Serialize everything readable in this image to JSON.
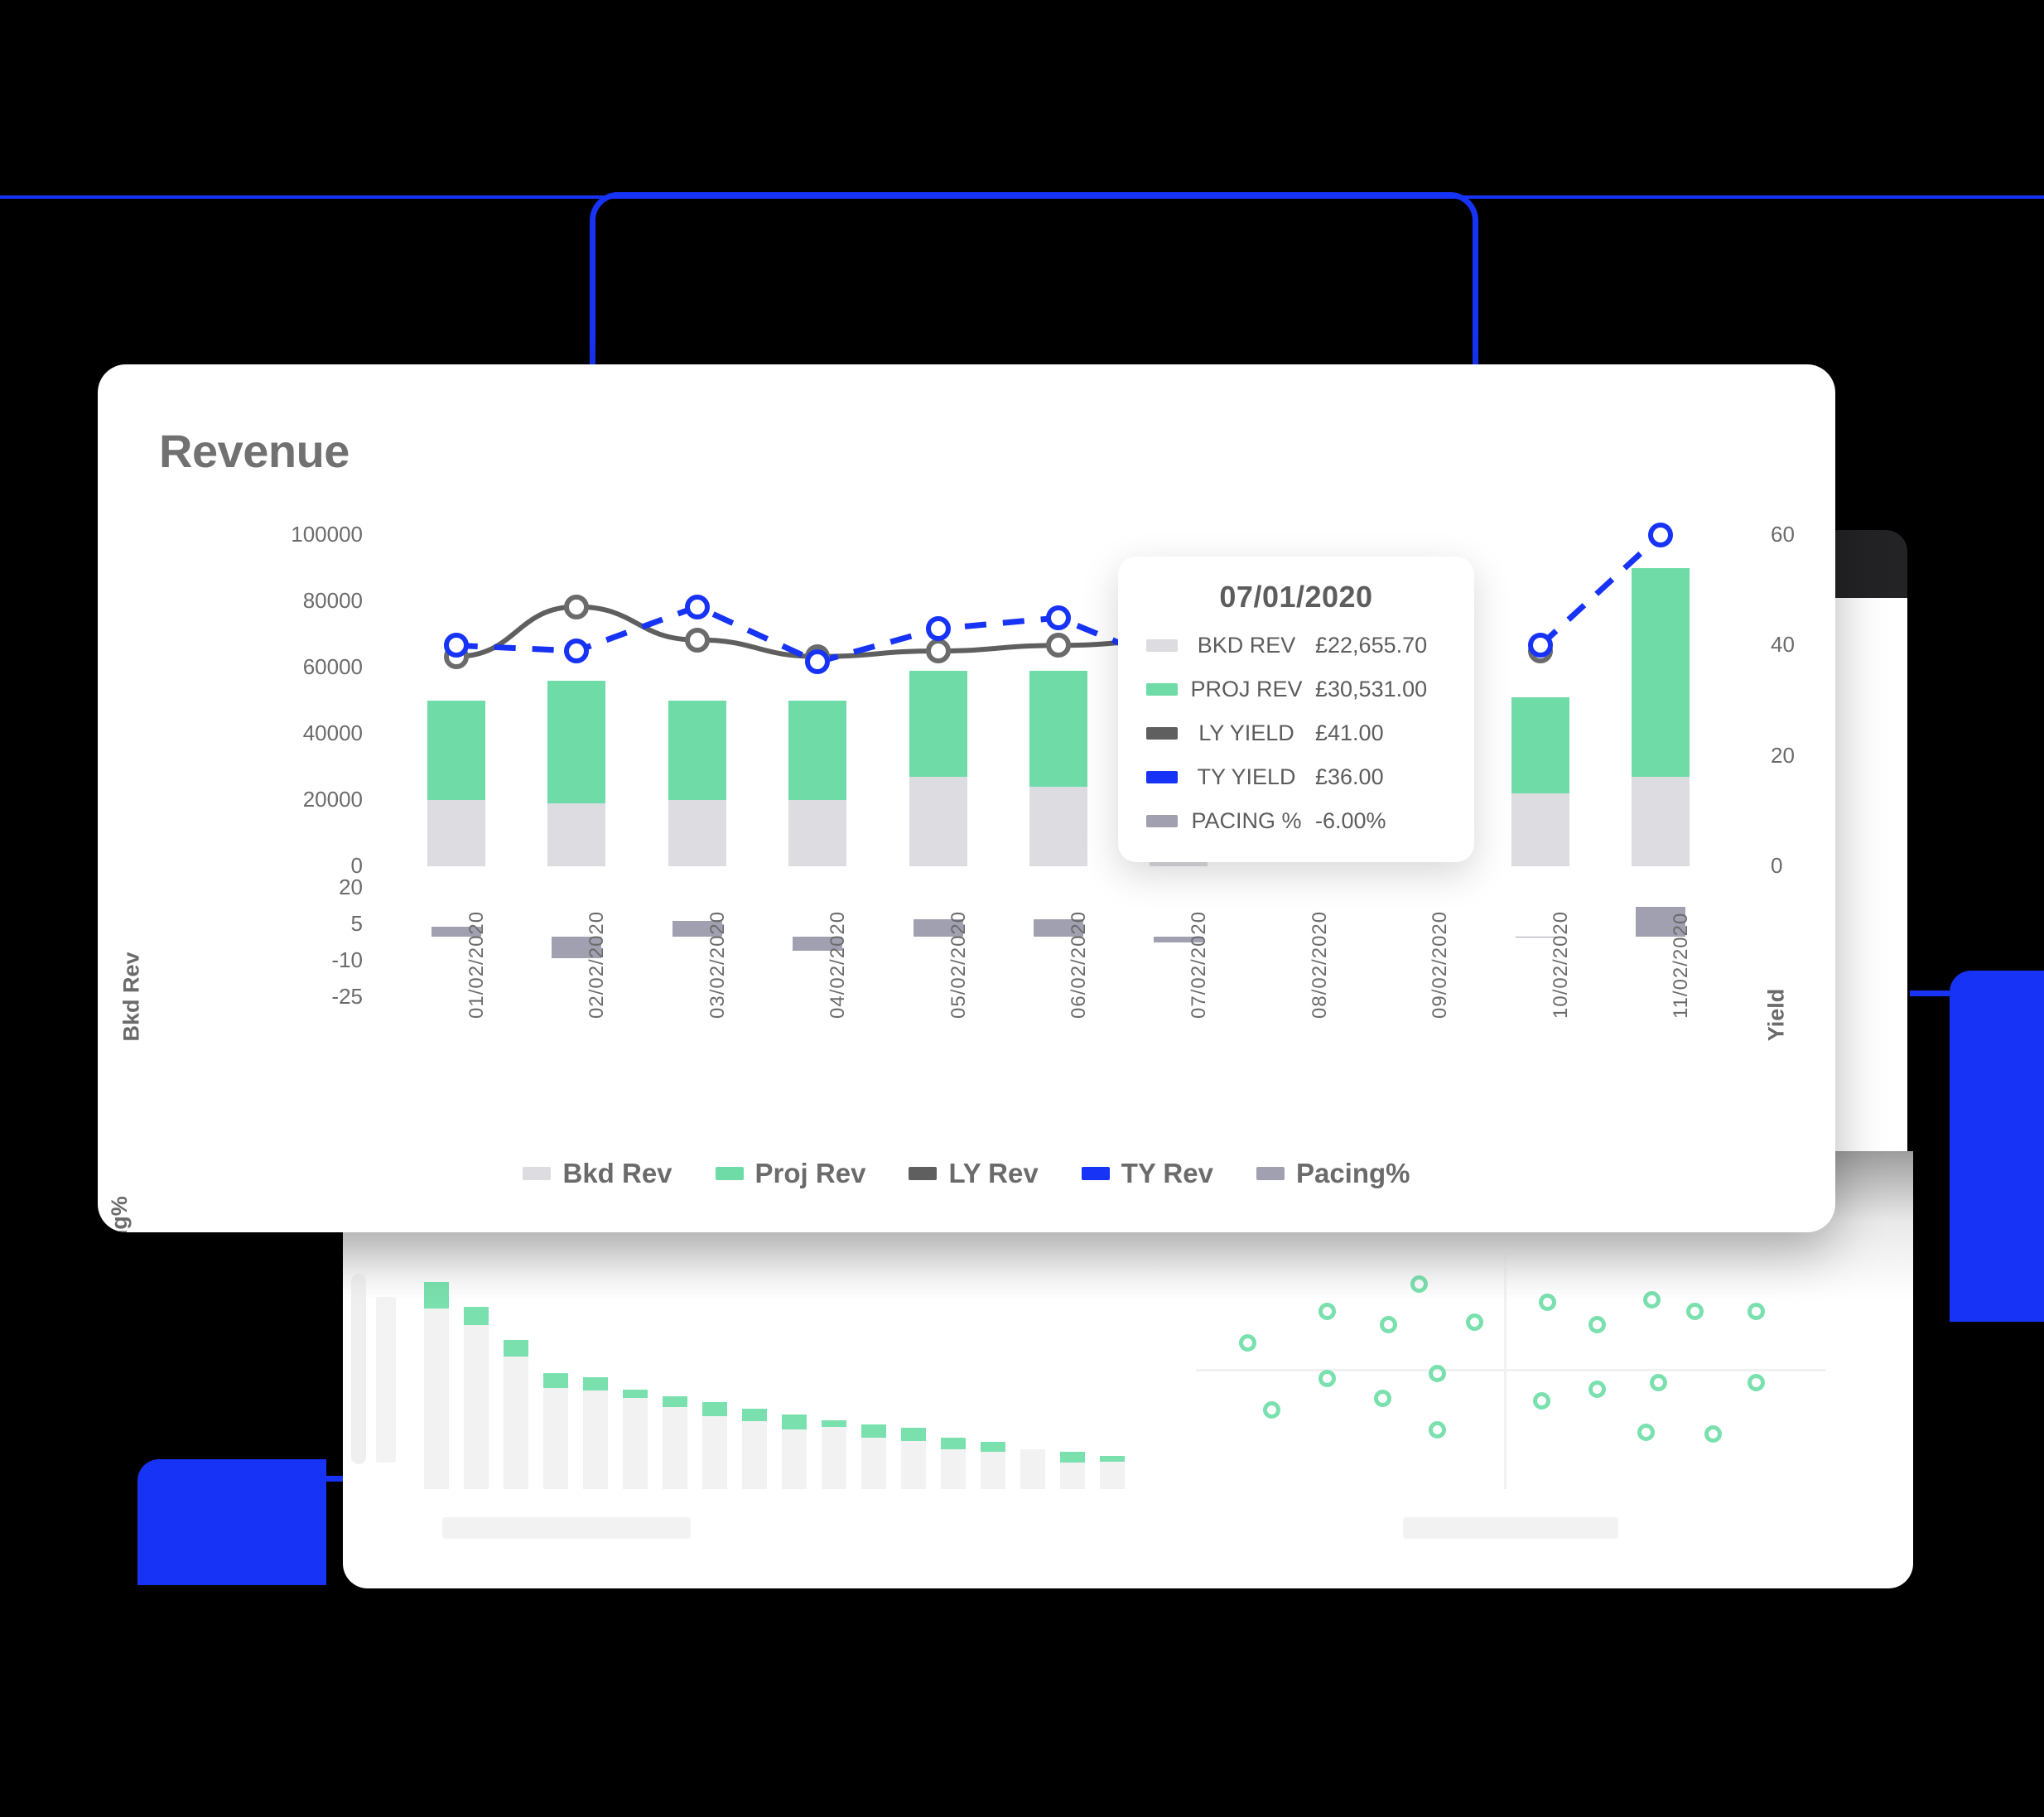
{
  "card": {
    "title": "Revenue"
  },
  "axes": {
    "left_top_label": "Bkd Rev",
    "left_bottom_label": "Pacing%",
    "right_label": "Yield",
    "rev_ticks": [
      "100000",
      "80000",
      "60000",
      "40000",
      "20000",
      "0"
    ],
    "pacing_ticks": [
      "20",
      "5",
      "-10",
      "-25"
    ],
    "yield_ticks": [
      "60",
      "40",
      "20",
      "0"
    ]
  },
  "legend": [
    {
      "label": "Bkd Rev",
      "color": "#DCDCE1"
    },
    {
      "label": "Proj Rev",
      "color": "#6FDCA8"
    },
    {
      "label": "LY Rev",
      "color": "#5F5F5F"
    },
    {
      "label": "TY Rev",
      "color": "#1733F5"
    },
    {
      "label": "Pacing%",
      "color": "#A0A0B0"
    }
  ],
  "tooltip": {
    "date": "07/01/2020",
    "rows": [
      {
        "name": "BKD REV",
        "value": "£22,655.70",
        "color": "#DCDCE1"
      },
      {
        "name": "PROJ REV",
        "value": "£30,531.00",
        "color": "#6FDCA8"
      },
      {
        "name": "LY YIELD",
        "value": "£41.00",
        "color": "#5F5F5F"
      },
      {
        "name": "TY YIELD",
        "value": "£36.00",
        "color": "#1733F5"
      },
      {
        "name": "PACING %",
        "value": "-6.00%",
        "color": "#A0A0B0"
      }
    ]
  },
  "chart_data": {
    "type": "bar",
    "title": "Revenue",
    "xlabel": "",
    "ylabel": "Bkd Rev",
    "y2label": "Yield",
    "y3label": "Pacing%",
    "ylim": [
      0,
      100000
    ],
    "y2lim": [
      0,
      60
    ],
    "y3lim": [
      -25,
      20
    ],
    "grid": false,
    "legend_position": "bottom",
    "categories": [
      "01/02/2020",
      "02/02/2020",
      "03/02/2020",
      "04/02/2020",
      "05/02/2020",
      "06/02/2020",
      "07/02/2020",
      "08/02/2020",
      "09/02/2020",
      "10/02/2020",
      "11/02/2020"
    ],
    "series": [
      {
        "name": "Bkd Rev",
        "type": "bar",
        "stack": "rev",
        "color": "#DCDCE1",
        "axis": "left",
        "values": [
          20000,
          19000,
          20000,
          20000,
          27000,
          24000,
          22656,
          0,
          0,
          22000,
          27000
        ]
      },
      {
        "name": "Proj Rev",
        "type": "bar",
        "stack": "rev",
        "color": "#6FDCA8",
        "axis": "left",
        "values": [
          30000,
          37000,
          30000,
          30000,
          32000,
          35000,
          30531,
          0,
          0,
          29000,
          63000
        ]
      },
      {
        "name": "LY Rev",
        "type": "line",
        "style": "solid",
        "color": "#5F5F5F",
        "axis": "right",
        "values": [
          38,
          47,
          41,
          38,
          39,
          40,
          41,
          null,
          null,
          39,
          null
        ]
      },
      {
        "name": "TY Rev",
        "type": "line",
        "style": "dashed",
        "color": "#1733F5",
        "axis": "right",
        "values": [
          40,
          39,
          47,
          37,
          43,
          45,
          36,
          null,
          null,
          40,
          60
        ]
      },
      {
        "name": "Pacing%",
        "type": "bar",
        "color": "#A0A0B0",
        "axis": "pacing",
        "values": [
          4.0,
          -9.0,
          6.5,
          -6.0,
          7.0,
          7.0,
          -2.5,
          0,
          0,
          -0.5,
          12.0
        ]
      }
    ]
  },
  "background_charts": {
    "bar_chart": {
      "type": "bar",
      "base_heights": [
        250,
        220,
        180,
        140,
        135,
        120,
        112,
        105,
        97,
        90,
        83,
        78,
        74,
        62,
        57,
        48,
        45,
        40
      ],
      "green_heights": [
        32,
        22,
        20,
        18,
        16,
        10,
        13,
        17,
        15,
        18,
        8,
        16,
        16,
        14,
        12,
        0,
        13,
        7
      ],
      "ghost_height": 200
    },
    "scatter_chart": {
      "type": "scatter",
      "points": [
        [
          0.07,
          0.62
        ],
        [
          0.2,
          0.76
        ],
        [
          0.3,
          0.7
        ],
        [
          0.35,
          0.88
        ],
        [
          0.44,
          0.71
        ],
        [
          0.56,
          0.8
        ],
        [
          0.64,
          0.7
        ],
        [
          0.73,
          0.81
        ],
        [
          0.8,
          0.76
        ],
        [
          0.9,
          0.76
        ],
        [
          0.11,
          0.32
        ],
        [
          0.2,
          0.46
        ],
        [
          0.29,
          0.37
        ],
        [
          0.38,
          0.48
        ],
        [
          0.38,
          0.23
        ],
        [
          0.55,
          0.36
        ],
        [
          0.64,
          0.41
        ],
        [
          0.74,
          0.44
        ],
        [
          0.72,
          0.22
        ],
        [
          0.83,
          0.21
        ],
        [
          0.9,
          0.44
        ]
      ]
    }
  }
}
